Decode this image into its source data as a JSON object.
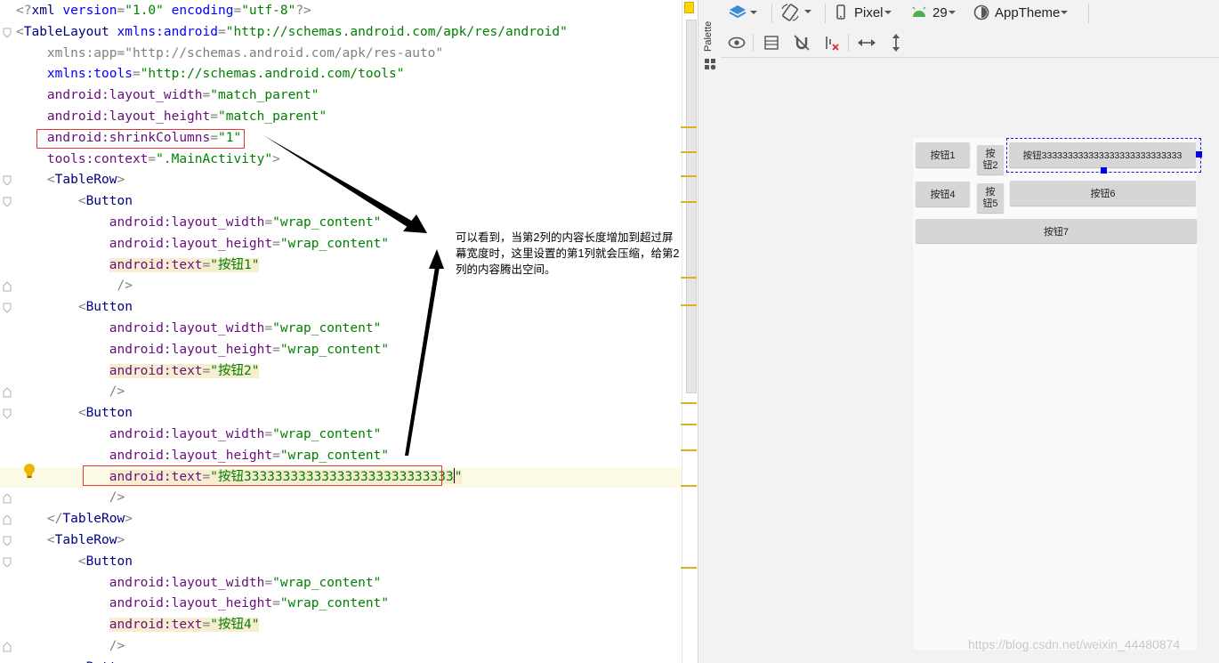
{
  "editor": {
    "lines": [
      {
        "fold": "",
        "parts": [
          [
            "pun",
            "<?"
          ],
          [
            "tag",
            "xml "
          ],
          [
            "attr",
            "version"
          ],
          [
            "pun",
            "="
          ],
          [
            "str",
            "\"1.0\""
          ],
          [
            "pun",
            " "
          ],
          [
            "attr",
            "encoding"
          ],
          [
            "pun",
            "="
          ],
          [
            "str",
            "\"utf-8\""
          ],
          [
            "pun",
            "?>"
          ]
        ]
      },
      {
        "fold": "open",
        "parts": [
          [
            "pun",
            "<"
          ],
          [
            "tag",
            "TableLayout "
          ],
          [
            "attr",
            "xmlns:android"
          ],
          [
            "pun",
            "="
          ],
          [
            "str",
            "\"http://schemas.android.com/apk/res/android\""
          ]
        ]
      },
      {
        "fold": "",
        "parts": [
          [
            "pun",
            "    "
          ],
          [
            "gray",
            "xmlns:app=\"http://schemas.android.com/apk/res-auto\""
          ]
        ]
      },
      {
        "fold": "",
        "parts": [
          [
            "pun",
            "    "
          ],
          [
            "attr",
            "xmlns:tools"
          ],
          [
            "pun",
            "="
          ],
          [
            "str",
            "\"http://schemas.android.com/tools\""
          ]
        ]
      },
      {
        "fold": "",
        "parts": [
          [
            "pun",
            "    "
          ],
          [
            "attr-ns",
            "android:layout_width"
          ],
          [
            "pun",
            "="
          ],
          [
            "str",
            "\"match_parent\""
          ]
        ]
      },
      {
        "fold": "",
        "parts": [
          [
            "pun",
            "    "
          ],
          [
            "attr-ns",
            "android:layout_height"
          ],
          [
            "pun",
            "="
          ],
          [
            "str",
            "\"match_parent\""
          ]
        ]
      },
      {
        "fold": "",
        "parts": [
          [
            "pun",
            "    "
          ],
          [
            "attr-ns",
            "android:shrinkColumns"
          ],
          [
            "pun",
            "="
          ],
          [
            "str",
            "\"1\""
          ]
        ]
      },
      {
        "fold": "",
        "parts": [
          [
            "pun",
            "    "
          ],
          [
            "attr-ns",
            "tools:context"
          ],
          [
            "pun",
            "="
          ],
          [
            "str",
            "\".MainActivity\""
          ],
          [
            "pun",
            ">"
          ]
        ]
      },
      {
        "fold": "open",
        "parts": [
          [
            "pun",
            "    <"
          ],
          [
            "tag",
            "TableRow"
          ],
          [
            "pun",
            ">"
          ]
        ]
      },
      {
        "fold": "open",
        "parts": [
          [
            "pun",
            "        <"
          ],
          [
            "tag",
            "Button"
          ]
        ]
      },
      {
        "fold": "",
        "parts": [
          [
            "pun",
            "            "
          ],
          [
            "attr-ns",
            "android:layout_width"
          ],
          [
            "pun",
            "="
          ],
          [
            "str",
            "\"wrap_content\""
          ]
        ]
      },
      {
        "fold": "",
        "parts": [
          [
            "pun",
            "            "
          ],
          [
            "attr-ns",
            "android:layout_height"
          ],
          [
            "pun",
            "="
          ],
          [
            "str",
            "\"wrap_content\""
          ]
        ]
      },
      {
        "fold": "",
        "parts": [
          [
            "pun",
            "            "
          ],
          [
            "attr-ns-hl",
            "android:text"
          ],
          [
            "pun-hl",
            "="
          ],
          [
            "str-hl",
            "\"按钮1\""
          ]
        ]
      },
      {
        "fold": "close",
        "parts": [
          [
            "pun",
            "             />"
          ]
        ]
      },
      {
        "fold": "open",
        "parts": [
          [
            "pun",
            "        <"
          ],
          [
            "tag",
            "Button"
          ]
        ]
      },
      {
        "fold": "",
        "parts": [
          [
            "pun",
            "            "
          ],
          [
            "attr-ns",
            "android:layout_width"
          ],
          [
            "pun",
            "="
          ],
          [
            "str",
            "\"wrap_content\""
          ]
        ]
      },
      {
        "fold": "",
        "parts": [
          [
            "pun",
            "            "
          ],
          [
            "attr-ns",
            "android:layout_height"
          ],
          [
            "pun",
            "="
          ],
          [
            "str",
            "\"wrap_content\""
          ]
        ]
      },
      {
        "fold": "",
        "parts": [
          [
            "pun",
            "            "
          ],
          [
            "attr-ns-hl",
            "android:text"
          ],
          [
            "pun-hl",
            "="
          ],
          [
            "str-hl",
            "\"按钮2\""
          ]
        ]
      },
      {
        "fold": "close",
        "parts": [
          [
            "pun",
            "            />"
          ]
        ]
      },
      {
        "fold": "open",
        "parts": [
          [
            "pun",
            "        <"
          ],
          [
            "tag",
            "Button"
          ]
        ]
      },
      {
        "fold": "",
        "parts": [
          [
            "pun",
            "            "
          ],
          [
            "attr-ns",
            "android:layout_width"
          ],
          [
            "pun",
            "="
          ],
          [
            "str",
            "\"wrap_content\""
          ]
        ]
      },
      {
        "fold": "",
        "parts": [
          [
            "pun",
            "            "
          ],
          [
            "attr-ns",
            "android:layout_height"
          ],
          [
            "pun",
            "="
          ],
          [
            "str",
            "\"wrap_content\""
          ]
        ]
      },
      {
        "fold": "",
        "current": true,
        "parts": [
          [
            "pun",
            "            "
          ],
          [
            "attr-ns-hl",
            "android:text"
          ],
          [
            "pun-hl",
            "="
          ],
          [
            "str-hl",
            "\"按钮333333333333333333333333333"
          ],
          [
            "caret",
            ""
          ],
          [
            "str-hl",
            "\""
          ]
        ]
      },
      {
        "fold": "close",
        "parts": [
          [
            "pun",
            "            />"
          ]
        ]
      },
      {
        "fold": "close",
        "parts": [
          [
            "pun",
            "    </"
          ],
          [
            "tag",
            "TableRow"
          ],
          [
            "pun",
            ">"
          ]
        ]
      },
      {
        "fold": "open",
        "parts": [
          [
            "pun",
            "    <"
          ],
          [
            "tag",
            "TableRow"
          ],
          [
            "pun",
            ">"
          ]
        ]
      },
      {
        "fold": "open",
        "parts": [
          [
            "pun",
            "        <"
          ],
          [
            "tag",
            "Button"
          ]
        ]
      },
      {
        "fold": "",
        "parts": [
          [
            "pun",
            "            "
          ],
          [
            "attr-ns",
            "android:layout_width"
          ],
          [
            "pun",
            "="
          ],
          [
            "str",
            "\"wrap_content\""
          ]
        ]
      },
      {
        "fold": "",
        "parts": [
          [
            "pun",
            "            "
          ],
          [
            "attr-ns",
            "android:layout_height"
          ],
          [
            "pun",
            "="
          ],
          [
            "str",
            "\"wrap_content\""
          ]
        ]
      },
      {
        "fold": "",
        "parts": [
          [
            "pun",
            "            "
          ],
          [
            "attr-ns-hl",
            "android:text"
          ],
          [
            "pun-hl",
            "="
          ],
          [
            "str-hl",
            "\"按钮4\""
          ]
        ]
      },
      {
        "fold": "close",
        "parts": [
          [
            "pun",
            "            />"
          ]
        ]
      },
      {
        "fold": "open",
        "parts": [
          [
            "pun",
            "        <"
          ],
          [
            "tag",
            "Button"
          ]
        ]
      }
    ],
    "annotation": "可以看到，当第2列的内容长度增加到超过屏幕宽度时，这里设置的第1列就会压缩，给第2列的内容腾出空间。"
  },
  "palette": {
    "label": "Palette"
  },
  "toolbar": {
    "device": "Pixel",
    "api": "29",
    "theme": "AppTheme"
  },
  "preview": {
    "row1": [
      "按钮1",
      "按钮2",
      "按钮333333333333333333333333333"
    ],
    "row2": [
      "按钮4",
      "按钮5",
      "按钮6"
    ],
    "row3": [
      "按钮7"
    ]
  },
  "watermark": "https://blog.csdn.net/weixin_44480874"
}
